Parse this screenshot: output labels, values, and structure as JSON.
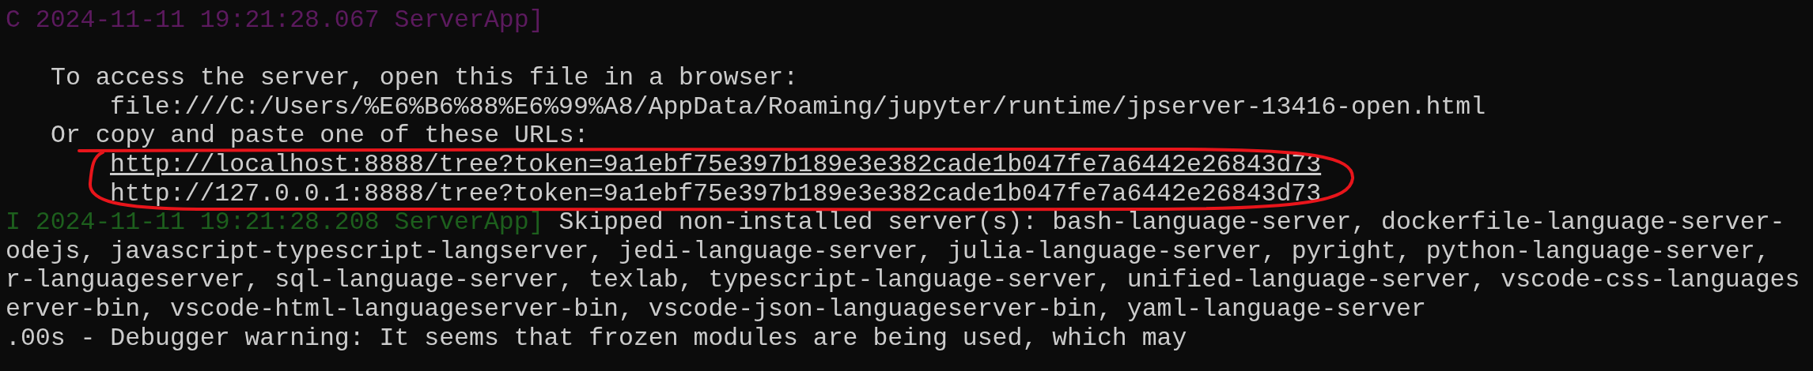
{
  "terminal": {
    "lines": [
      {
        "kind": "edge",
        "segments": [
          {
            "kind": "critical",
            "text": "C 2024-11-11 19:21:28.067 ServerApp]"
          }
        ]
      },
      {
        "kind": "blank"
      },
      {
        "kind": "indent",
        "segments": [
          {
            "kind": "plain",
            "text": "To access the server, open this file in a browser:"
          }
        ]
      },
      {
        "kind": "deep",
        "segments": [
          {
            "kind": "plain",
            "text": "file:///C:/Users/%E6%B6%88%E6%99%A8/AppData/Roaming/jupyter/runtime/jpserver-13416-open.html"
          }
        ]
      },
      {
        "kind": "indent",
        "segments": [
          {
            "kind": "plain",
            "text": "Or copy and paste one of these URLs:"
          }
        ]
      },
      {
        "kind": "deep",
        "segments": [
          {
            "kind": "link",
            "text": "http://localhost:8888/tree?token=9a1ebf75e397b189e3e382cade1b047fe7a6442e26843d73"
          }
        ]
      },
      {
        "kind": "deep",
        "segments": [
          {
            "kind": "plain",
            "text": "http://127.0.0.1:8888/tree?token=9a1ebf75e397b189e3e382cade1b047fe7a6442e26843d73"
          }
        ]
      },
      {
        "kind": "edge",
        "segments": [
          {
            "kind": "info",
            "text": "I 2024-11-11 19:21:28.208 ServerApp]"
          },
          {
            "kind": "plain",
            "text": "Skipped non-installed server(s): bash-language-server, dockerfile-language-server-"
          }
        ]
      },
      {
        "kind": "edge",
        "segments": [
          {
            "kind": "plain",
            "text": "odejs, javascript-typescript-langserver, jedi-language-server, julia-language-server, pyright, python-language-server,"
          }
        ]
      },
      {
        "kind": "edge",
        "segments": [
          {
            "kind": "plain",
            "text": "r-languageserver, sql-language-server, texlab, typescript-language-server, unified-language-server, vscode-css-languages"
          }
        ]
      },
      {
        "kind": "edge",
        "segments": [
          {
            "kind": "plain",
            "text": "erver-bin, vscode-html-languageserver-bin, vscode-json-languageserver-bin, yaml-language-server"
          }
        ]
      },
      {
        "kind": "edge",
        "segments": [
          {
            "kind": "plain",
            "text": ".00s - Debugger warning: It seems that frozen modules are being used, which may"
          }
        ]
      }
    ]
  },
  "annotation": {
    "kind": "circled"
  }
}
